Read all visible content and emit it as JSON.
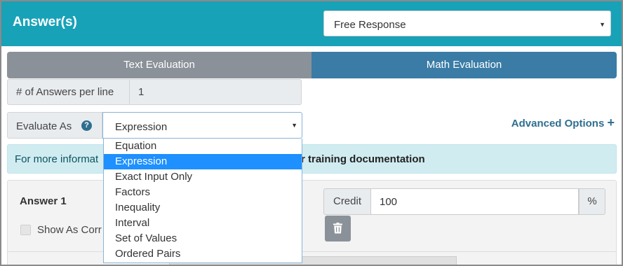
{
  "header": {
    "title": "Answer(s)",
    "response_type": "Free Response"
  },
  "tabs": [
    {
      "label": "Text Evaluation"
    },
    {
      "label": "Math Evaluation"
    }
  ],
  "answers_per_line": {
    "label": "# of Answers per line",
    "value": "1"
  },
  "evaluate": {
    "label": "Evaluate As",
    "help_icon": "question-circle-icon",
    "selected": "Expression",
    "options": [
      "Equation",
      "Expression",
      "Exact Input Only",
      "Factors",
      "Inequality",
      "Interval",
      "Set of Values",
      "Ordered Pairs"
    ],
    "highlighted_index": 1
  },
  "advanced_options": {
    "label": "Advanced Options",
    "icon": "plus-icon"
  },
  "info_bar": {
    "text_visible": "For more informat",
    "link_visible": "r training documentation"
  },
  "answer": {
    "title": "Answer 1",
    "show_label": "Show As Corr",
    "credit_label": "Credit",
    "credit_value": "100",
    "credit_suffix": "%",
    "delete_icon": "trash-icon"
  },
  "colors": {
    "header_bg": "#17a2b8",
    "tab_inactive": "#8b9198",
    "tab_active": "#3a7ca5",
    "info_bg": "#d1ecf1",
    "selected_option": "#1e90ff",
    "link": "#2e6f8f"
  }
}
